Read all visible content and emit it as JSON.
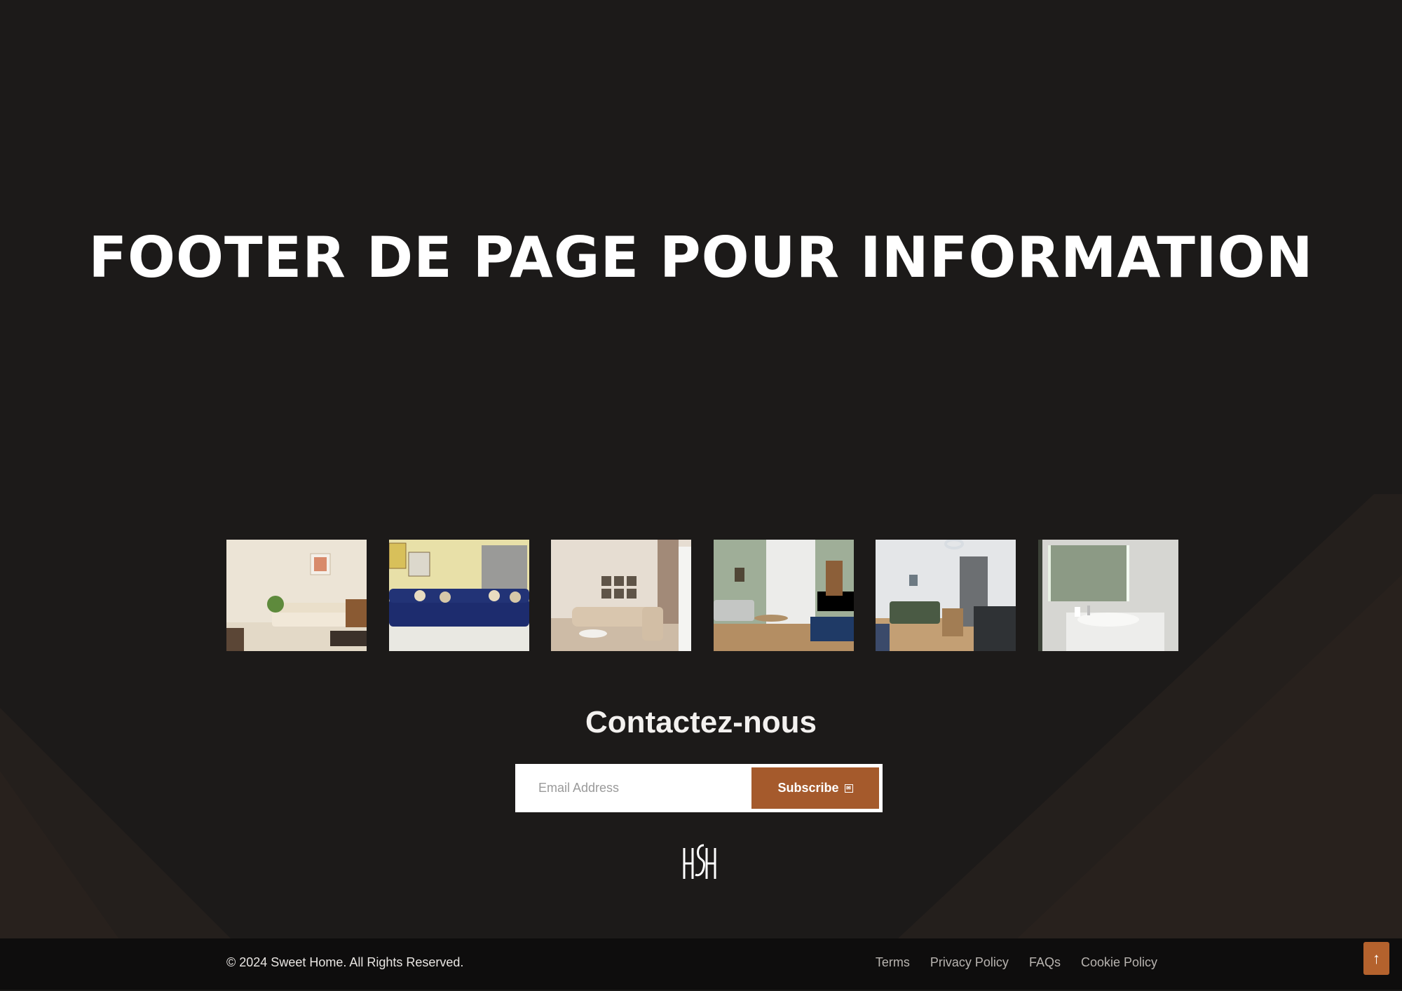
{
  "hero": {
    "title": "FOOTER DE PAGE POUR INFORMATION"
  },
  "gallery": {
    "images": [
      {
        "name": "gallery-image-beige-living-room"
      },
      {
        "name": "gallery-image-blue-sofa"
      },
      {
        "name": "gallery-image-sectional-sofa"
      },
      {
        "name": "gallery-image-green-wall-studio"
      },
      {
        "name": "gallery-image-dining-room"
      },
      {
        "name": "gallery-image-bathroom"
      }
    ]
  },
  "contact": {
    "title": "Contactez-nous",
    "email_placeholder": "Email Address",
    "subscribe_label": "Subscribe"
  },
  "logo": {
    "text": "HSH"
  },
  "footer": {
    "copyright": "© 2024 Sweet Home. All Rights Reserved.",
    "links": [
      "Terms",
      "Privacy Policy",
      "FAQs",
      "Cookie Policy"
    ]
  },
  "icons": {
    "subscribe": "mail-icon",
    "back_to_top": "arrow-up-icon"
  },
  "colors": {
    "background": "#1c1a19",
    "accent": "#a55a2c",
    "bottom_bar": "#0e0d0d"
  }
}
